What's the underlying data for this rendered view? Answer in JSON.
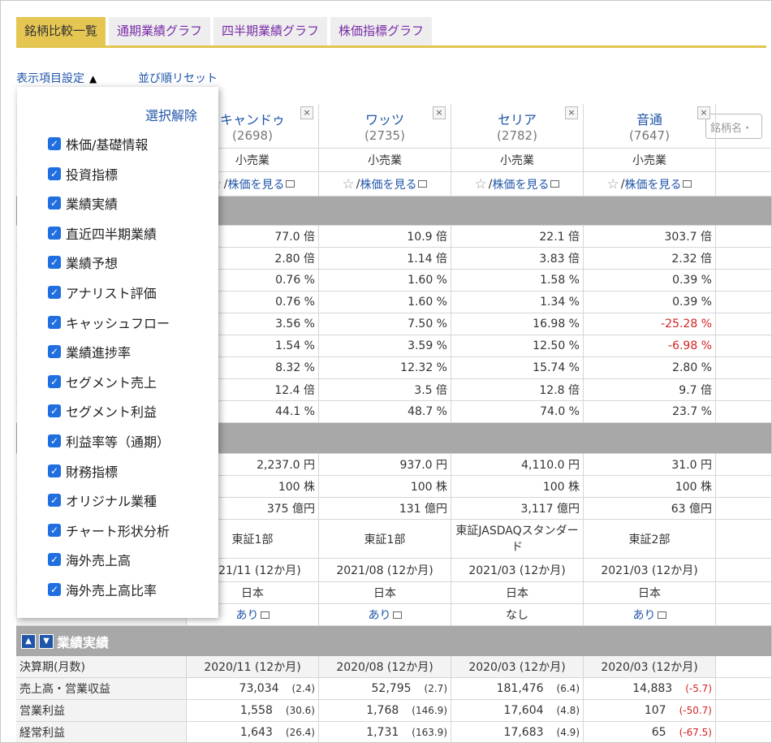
{
  "tabs": [
    "銘柄比較一覧",
    "通期業績グラフ",
    "四半期業績グラフ",
    "株価指標グラフ"
  ],
  "toolbar": {
    "display_settings": "表示項目設定",
    "sort_reset": "並び順リセット",
    "toggle_glyph": "▲"
  },
  "popup": {
    "clear_label": "選択解除",
    "items": [
      "株価/基礎情報",
      "投資指標",
      "業績実績",
      "直近四半期業績",
      "業績予想",
      "アナリスト評価",
      "キャッシュフロー",
      "業績進捗率",
      "セグメント売上",
      "セグメント利益",
      "利益率等（通期）",
      "財務指標",
      "オリジナル業種",
      "チャート形状分析",
      "海外売上高",
      "海外売上高比率"
    ]
  },
  "search_placeholder": "銘柄名・",
  "stocks": [
    {
      "name": "キャンドゥ",
      "code": "(2698)",
      "industry": "小売業",
      "view": "株価を見る"
    },
    {
      "name": "ワッツ",
      "code": "(2735)",
      "industry": "小売業",
      "view": "株価を見る"
    },
    {
      "name": "セリア",
      "code": "(2782)",
      "industry": "小売業",
      "view": "株価を見る"
    },
    {
      "name": "音通",
      "code": "(7647)",
      "industry": "小売業",
      "view": "株価を見る"
    }
  ],
  "close_glyph": "×",
  "metrics": [
    [
      "77.0 倍",
      "10.9 倍",
      "22.1 倍",
      "303.7 倍"
    ],
    [
      "2.80 倍",
      "1.14 倍",
      "3.83 倍",
      "2.32 倍"
    ],
    [
      "0.76 %",
      "1.60 %",
      "1.58 %",
      "0.39 %"
    ],
    [
      "0.76 %",
      "1.60 %",
      "1.34 %",
      "0.39 %"
    ],
    [
      "3.56 %",
      "7.50 %",
      "16.98 %",
      "-25.28 %"
    ],
    [
      "1.54 %",
      "3.59 %",
      "12.50 %",
      "-6.98 %"
    ],
    [
      "8.32 %",
      "12.32 %",
      "15.74 %",
      "2.80 %"
    ],
    [
      "12.4 倍",
      "3.5 倍",
      "12.8 倍",
      "9.7 倍"
    ],
    [
      "44.1 %",
      "48.7 %",
      "74.0 %",
      "23.7 %"
    ]
  ],
  "basic": [
    [
      "2,237.0 円",
      "937.0 円",
      "4,110.0 円",
      "31.0 円"
    ],
    [
      "100 株",
      "100 株",
      "100 株",
      "100 株"
    ],
    [
      "375 億円",
      "131 億円",
      "3,117 億円",
      "63 億円"
    ]
  ],
  "market": [
    "東証1部",
    "東証1部",
    "東証JASDAQスタンダード",
    "東証2部"
  ],
  "fiscal": [
    "2021/11 (12か月)",
    "2021/08 (12か月)",
    "2021/03 (12か月)",
    "2021/03 (12か月)"
  ],
  "country": [
    "日本",
    "日本",
    "日本",
    "日本"
  ],
  "exists": [
    "あり",
    "あり",
    "なし",
    "あり"
  ],
  "results": {
    "title": "業績実績",
    "period_label": "決算期(月数)",
    "periods": [
      "2020/11 (12か月)",
      "2020/08 (12か月)",
      "2020/03 (12か月)",
      "2020/03 (12か月)"
    ],
    "rows": [
      {
        "label": "売上高・営業収益",
        "values": [
          "73,034",
          "52,795",
          "181,476",
          "14,883"
        ],
        "changes": [
          "(2.4)",
          "(2.7)",
          "(6.4)",
          "(-5.7)"
        ]
      },
      {
        "label": "営業利益",
        "values": [
          "1,558",
          "1,768",
          "17,604",
          "107"
        ],
        "changes": [
          "(30.6)",
          "(146.9)",
          "(4.8)",
          "(-50.7)"
        ]
      },
      {
        "label": "経常利益",
        "values": [
          "1,643",
          "1,731",
          "17,683",
          "65"
        ],
        "changes": [
          "(26.4)",
          "(163.9)",
          "(4.9)",
          "(-67.5)"
        ]
      }
    ]
  }
}
